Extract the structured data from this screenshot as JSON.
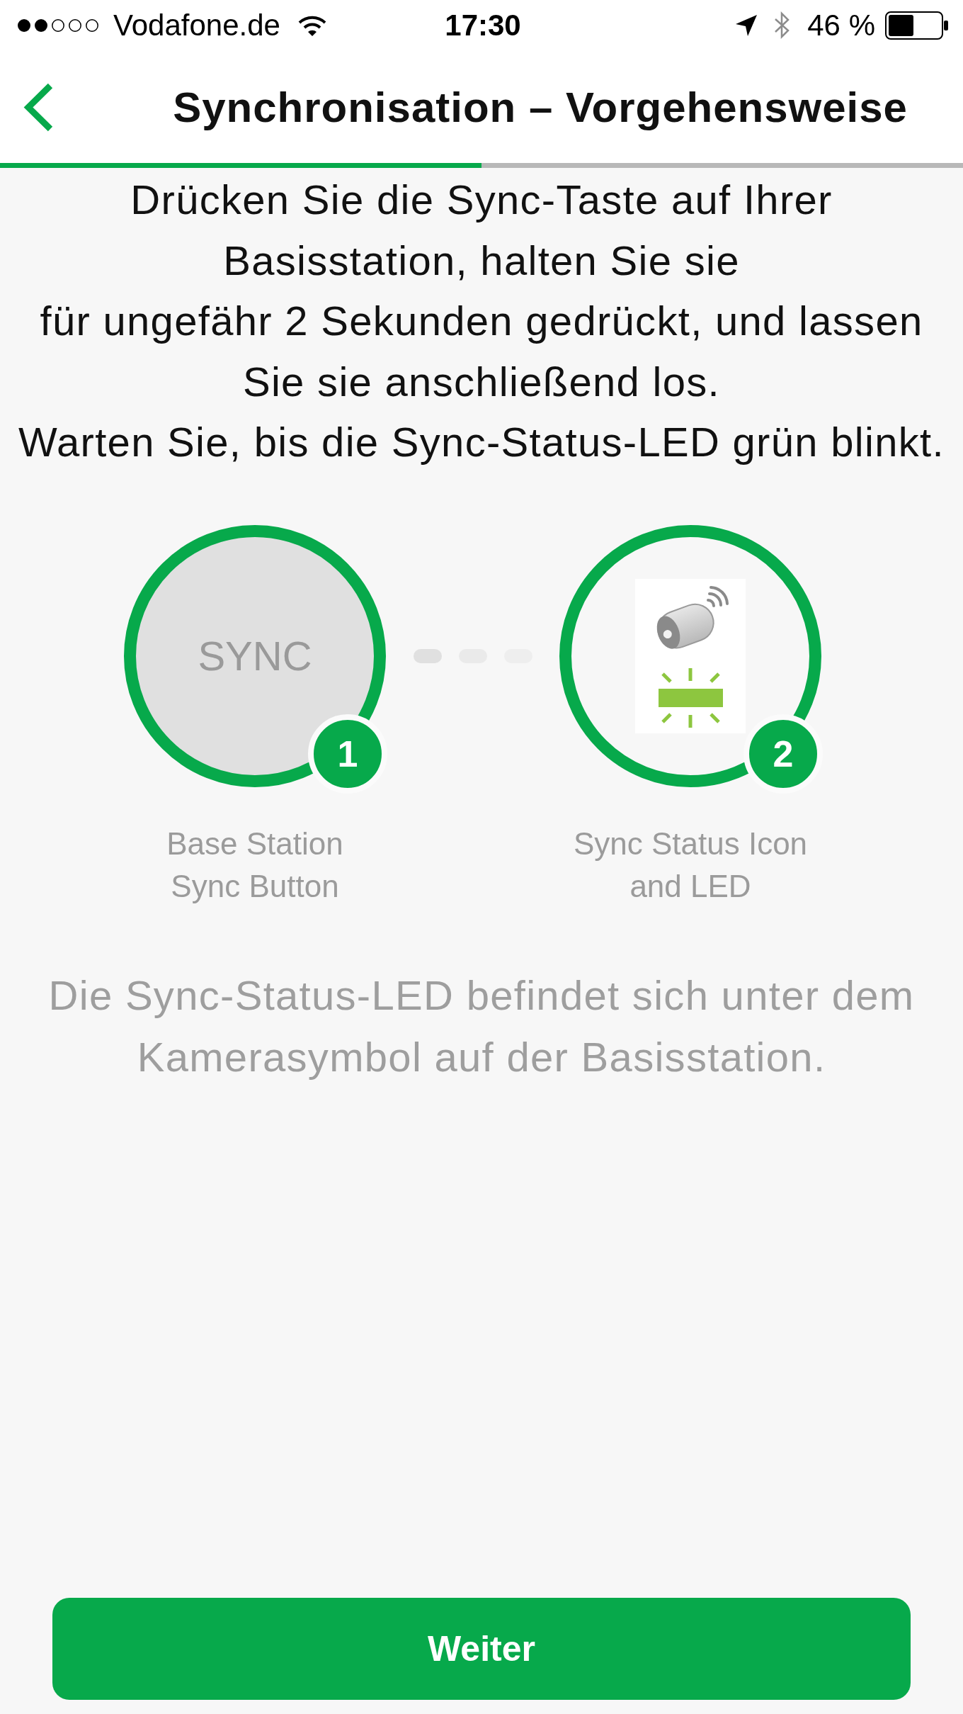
{
  "status_bar": {
    "carrier": "Vodafone.de",
    "time": "17:30",
    "battery": "46 %"
  },
  "header": {
    "title": "Synchronisation – Vorgehensweise"
  },
  "progress": {
    "level": 0.5
  },
  "instructions": [
    "Drücken Sie die Sync-Taste auf Ihrer\nBasisstation, halten Sie sie\nfür ungefähr 2 Sekunden gedrückt, und lassen\nSie sie anschließend los.",
    "Warten Sie, bis die Sync-Status-LED grün blinkt."
  ],
  "steps": [
    {
      "kind": "button",
      "label": "SYNC",
      "number": "1",
      "caption": "Base Station\nSync Button"
    },
    {
      "kind": "led",
      "number": "2",
      "caption": "Sync Status Icon\nand LED"
    }
  ],
  "note": "Die Sync-Status-LED befindet sich unter dem\nKamerasymbol auf der Basisstation.",
  "button": {
    "label": "Weiter"
  }
}
